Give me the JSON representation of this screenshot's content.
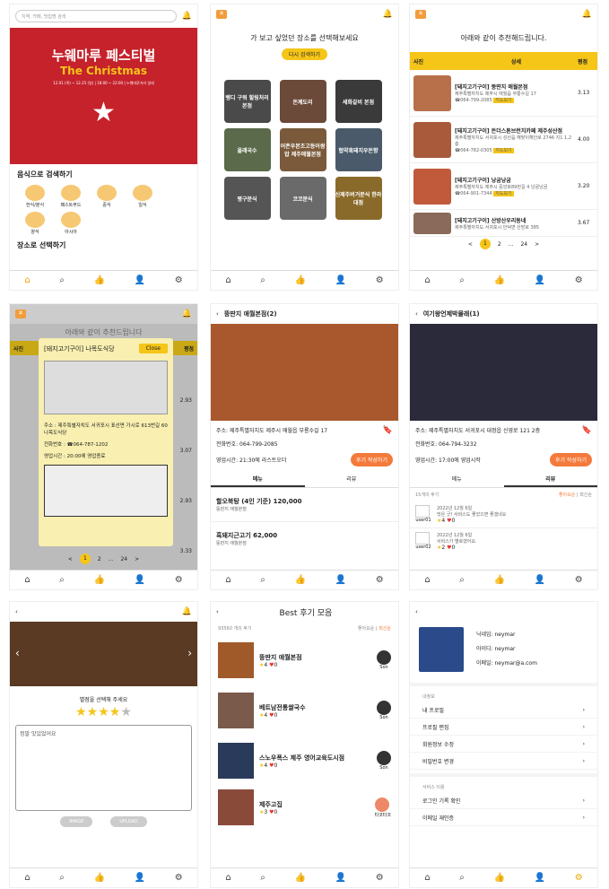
{
  "s1": {
    "search_ph": "지역, 카페, 맛집명 검색",
    "banner_title": "누웨마루 페스티벌",
    "banner_sub": "The Christmas",
    "banner_date": "12.01 (목) ~ 12.25 (일) | 18:00 ~ 22:00 | 누웨마루거리 일대",
    "food_header": "음식으로 검색하기",
    "cats": [
      "한식/분식",
      "패스트푸드",
      "중식",
      "일식",
      "양식",
      "아시아"
    ],
    "place_header": "장소로 선택하기"
  },
  "s2": {
    "title": "가 보고 싶었던 장소를 선택해보세요",
    "retry": "다시 검색하기",
    "tiles": [
      "벵디 구워 힐링처리 본점",
      "돈께도리",
      "세화갈비 본점",
      "올래국수",
      "어존우본조고등어쌈밥 제주애월본점",
      "협약흑돼지우돈향",
      "평구분식",
      "코코분식",
      "신제주버거분식 한라대점"
    ]
  },
  "s3": {
    "title": "아래와 같이 추천해드립니다.",
    "cols": [
      "사진",
      "상세",
      "평점"
    ],
    "rows": [
      {
        "name": "[돼지고기구이] 뚱딴지 애월본점",
        "addr": "제주특별자치도 제주시 애월읍 부룡수길 17",
        "tel": "☎064-799-2085",
        "tag": "지도보기",
        "score": "3.13"
      },
      {
        "name": "[돼지고기구이] 돈더스톤브런치카페 제주성산점",
        "addr": "제주특별자치도 서귀포시 성산읍 해맞이해안로 2746 지1 1,2층",
        "tel": "☎064-782-0305",
        "tag": "지도보기",
        "score": "4.00"
      },
      {
        "name": "[돼지고기구이] 낭굼낭굼",
        "addr": "제주특별자치도 제주시 중앙로89번길 4 낭굼낭굼",
        "tel": "☎064-901-7344",
        "tag": "지도보기",
        "score": "3.20"
      },
      {
        "name": "[돼지고기구이] 산방산우리동네",
        "addr": "제주특별자치도 서귀포시 안덕면 산방로 385",
        "tel": "",
        "tag": "",
        "score": "3.67"
      }
    ],
    "pages": [
      "<",
      "1",
      "2",
      "...",
      "24",
      ">"
    ]
  },
  "s4": {
    "bg_title": "아래와 같이 추천드립니다",
    "popup_title": "[돼지고기구이] 나목도식당",
    "close": "Close",
    "addr": "주소 : 제주특별자치도 서귀포시 표선면 가시로 613번길 60 나목도식당",
    "tel": "전화번호 : ☎064-787-1202",
    "hours": "영업시간 : 20:00에 영업종료",
    "scores": [
      "2.93",
      "3.07",
      "2.93",
      "3.33"
    ],
    "col_photo": "사진",
    "col_score": "평점",
    "pages": [
      "<",
      "1",
      "2",
      "...",
      "24",
      ">"
    ]
  },
  "s5": {
    "title": "뚱딴지 애월본점(2)",
    "addr": "주소: 제주특별자치도 제주시 애월읍 부룡수길 17",
    "tel": "전화번호: 064-799-2085",
    "hours": "영업시간: 21:30에 라스트오더",
    "review_btn": "후기 작성하기",
    "tabs": [
      "메뉴",
      "리뷰"
    ],
    "menu": [
      {
        "name": "할오북탕 (4인 기준) 120,000",
        "shop": "뚱딴지 애월본점"
      },
      {
        "name": "흑돼지근고기 62,000",
        "shop": "뚱딴지 애월본점"
      }
    ]
  },
  "s6": {
    "title": "여기왕언제박물래(1)",
    "addr": "주소: 제주특별자치도 서귀포시 대정읍 신영로 121 2층",
    "tel": "전화번호: 064-794-3232",
    "hours": "영업시간: 17:00에 영업시작",
    "review_btn": "후기 작성하기",
    "tabs": [
      "메뉴",
      "리뷰"
    ],
    "count": "15개의 후기",
    "sort": [
      "좋아요순",
      "최신순"
    ],
    "reviews": [
      {
        "date": "2022년 12월 6일",
        "text": "맛은 굿! 서비스도 좋았으면 좋겠네요",
        "user": "user01",
        "stars": "4",
        "likes": "0"
      },
      {
        "date": "2022년 12월 6일",
        "text": "서비스가 별로였어요.",
        "user": "user02",
        "stars": "2",
        "likes": "0"
      }
    ]
  },
  "s7": {
    "prompt": "별점을 선택해 주세요",
    "text": "정말 맛있었어요",
    "image_btn": "IMAGE",
    "upload_btn": "UPLOAD",
    "rating": 4
  },
  "s8": {
    "title": "Best 후기 모음",
    "count": "93560 개의 후기",
    "sort": [
      "좋아요순",
      "최신순"
    ],
    "items": [
      {
        "name": "뚱딴지 애월본점",
        "stars": "4",
        "likes": "0",
        "user": "Son"
      },
      {
        "name": "베트남전통쌀국수",
        "stars": "4",
        "likes": "0",
        "user": "Son"
      },
      {
        "name": "스노우폭스 제주 영어교육도시점",
        "stars": "4",
        "likes": "0",
        "user": "Son"
      },
      {
        "name": "제주고집",
        "stars": "3",
        "likes": "0",
        "user": "타코타코"
      }
    ]
  },
  "s9": {
    "nick": "닉네임: neymar",
    "id": "아이디: neymar",
    "email": "이메일: neymar@a.com",
    "sec1": "내정보",
    "items1": [
      "내 프로필",
      "프로필 편집",
      "회원정보 수정",
      "비밀번호 변경"
    ],
    "sec2": "서비스 이용",
    "items2": [
      "로그인 기록 확인",
      "이메일 재인증"
    ]
  }
}
